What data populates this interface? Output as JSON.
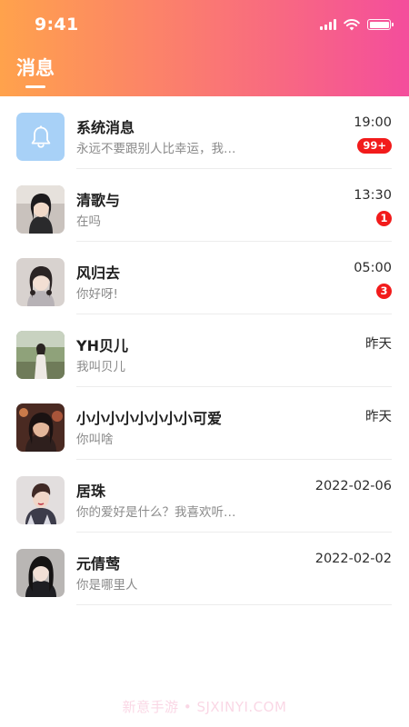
{
  "status_bar": {
    "time": "9:41",
    "icons": [
      "signal-icon",
      "wifi-icon",
      "battery-icon"
    ]
  },
  "header": {
    "title": "消息",
    "gradient": [
      "#ffa24c",
      "#fb7d6e",
      "#f44d9c"
    ]
  },
  "conversations": [
    {
      "name": "系统消息",
      "preview": "永远不要跟别人比幸运，我…",
      "time": "19:00",
      "badge": "99+",
      "avatar": "bell-icon"
    },
    {
      "name": "清歌与",
      "preview": "在吗",
      "time": "13:30",
      "badge": "1",
      "avatar": "user-photo"
    },
    {
      "name": "风归去",
      "preview": "你好呀!",
      "time": "05:00",
      "badge": "3",
      "avatar": "user-photo"
    },
    {
      "name": "YH贝儿",
      "preview": "我叫贝儿",
      "time": "昨天",
      "badge": "",
      "avatar": "user-photo"
    },
    {
      "name": "小小小小小小小小可爱",
      "preview": "你叫啥",
      "time": "昨天",
      "badge": "",
      "avatar": "user-photo"
    },
    {
      "name": "居珠",
      "preview": "你的爱好是什么？我喜欢听…",
      "time": "2022-02-06",
      "badge": "",
      "avatar": "user-photo"
    },
    {
      "name": "元倩莺",
      "preview": "你是哪里人",
      "time": "2022-02-02",
      "badge": "",
      "avatar": "user-photo"
    }
  ],
  "colors": {
    "badge": "#f21b1b",
    "system_avatar_bg": "#a8d1f7"
  },
  "watermark": "新意手游 • SJXINYI.COM"
}
